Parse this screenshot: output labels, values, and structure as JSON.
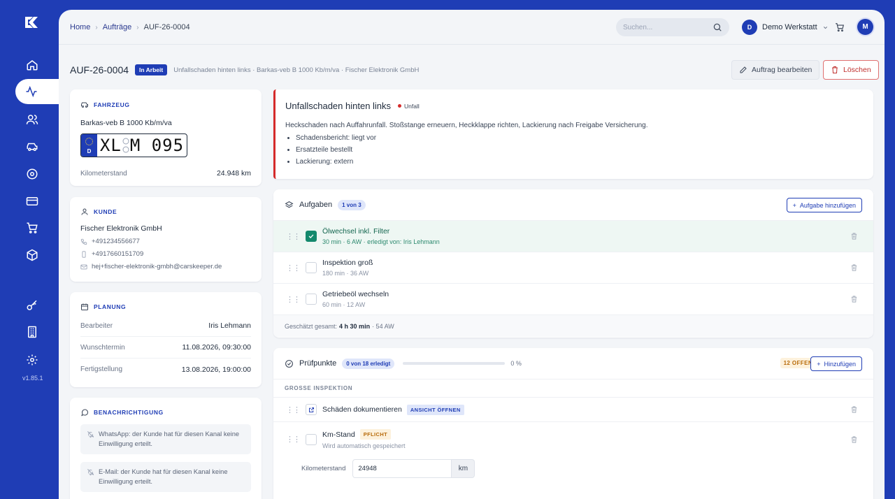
{
  "app": {
    "version": "v1.85.1"
  },
  "breadcrumb": {
    "home": "Home",
    "orders": "Aufträge",
    "current": "AUF-26-0004"
  },
  "header": {
    "search_placeholder": "Suchen...",
    "workspace_initial": "D",
    "workspace_name": "Demo Werkstatt",
    "user_initial": "M"
  },
  "order": {
    "id": "AUF-26-0004",
    "status": "In Arbeit",
    "subtitle": "Unfallschaden hinten links · Barkas-veb B 1000 Kb/m/va · Fischer Elektronik GmbH",
    "edit_label": "Auftrag bearbeiten",
    "delete_label": "Löschen"
  },
  "vehicle": {
    "title": "Fahrzeug",
    "name": "Barkas-veb B 1000 Kb/m/va",
    "plate_country": "D",
    "plate_left": "XL",
    "plate_right": "M 095",
    "mileage_label": "Kilometerstand",
    "mileage_value": "24.948 km"
  },
  "customer": {
    "title": "Kunde",
    "name": "Fischer Elektronik GmbH",
    "phone": "+491234556677",
    "mobile": "+4917660151709",
    "email": "hej+fischer-elektronik-gmbh@carskeeper.de"
  },
  "planning": {
    "title": "Planung",
    "rows": [
      {
        "label": "Bearbeiter",
        "value": "Iris Lehmann"
      },
      {
        "label": "Wunschtermin",
        "value": "11.08.2026, 09:30:00"
      },
      {
        "label": "Fertigstellung",
        "value": "13.08.2026, 19:00:00"
      }
    ]
  },
  "notification": {
    "title": "Benachrichtigung",
    "whatsapp": "WhatsApp: der Kunde hat für diesen Kanal keine Einwilligung erteilt.",
    "email": "E-Mail: der Kunde hat für diesen Kanal keine Einwilligung erteilt."
  },
  "incident": {
    "title": "Unfallschaden hinten links",
    "tag": "Unfall",
    "description": "Heckschaden nach Auffahrunfall. Stoßstange erneuern, Heckklappe richten, Lackierung nach Freigabe Versicherung.",
    "bullets": [
      "Schadensbericht: liegt vor",
      "Ersatzteile bestellt",
      "Lackierung: extern"
    ]
  },
  "tasks": {
    "title": "Aufgaben",
    "count": "1 von 3",
    "add_label": "Aufgabe hinzufügen",
    "items": [
      {
        "title": "Ölwechsel inkl. Filter",
        "meta": "30 min · 6 AW · erledigt von: Iris Lehmann",
        "done": true
      },
      {
        "title": "Inspektion groß",
        "meta": "180 min · 36 AW",
        "done": false
      },
      {
        "title": "Getriebeöl wechseln",
        "meta": "60 min · 12 AW",
        "done": false
      }
    ],
    "total_label": "Geschätzt gesamt:",
    "total_value": "4 h 30 min",
    "total_aw": "· 54 AW"
  },
  "checks": {
    "title": "Prüfpunkte",
    "count": "0 von 18 erledigt",
    "progress": 0,
    "progress_label": "0 %",
    "open_badge": "12 OFFEN",
    "add_label": "Hinzufügen",
    "group": "GROSSE INSPEKTION",
    "items": [
      {
        "title": "Schäden dokumentieren",
        "badge": "ANSICHT ÖFFNEN"
      },
      {
        "title": "Km-Stand",
        "badge": "PFLICHT",
        "hint": "Wird automatisch gespeichert"
      }
    ],
    "km_label": "Kilometerstand",
    "km_value": "24948",
    "km_unit": "km"
  }
}
